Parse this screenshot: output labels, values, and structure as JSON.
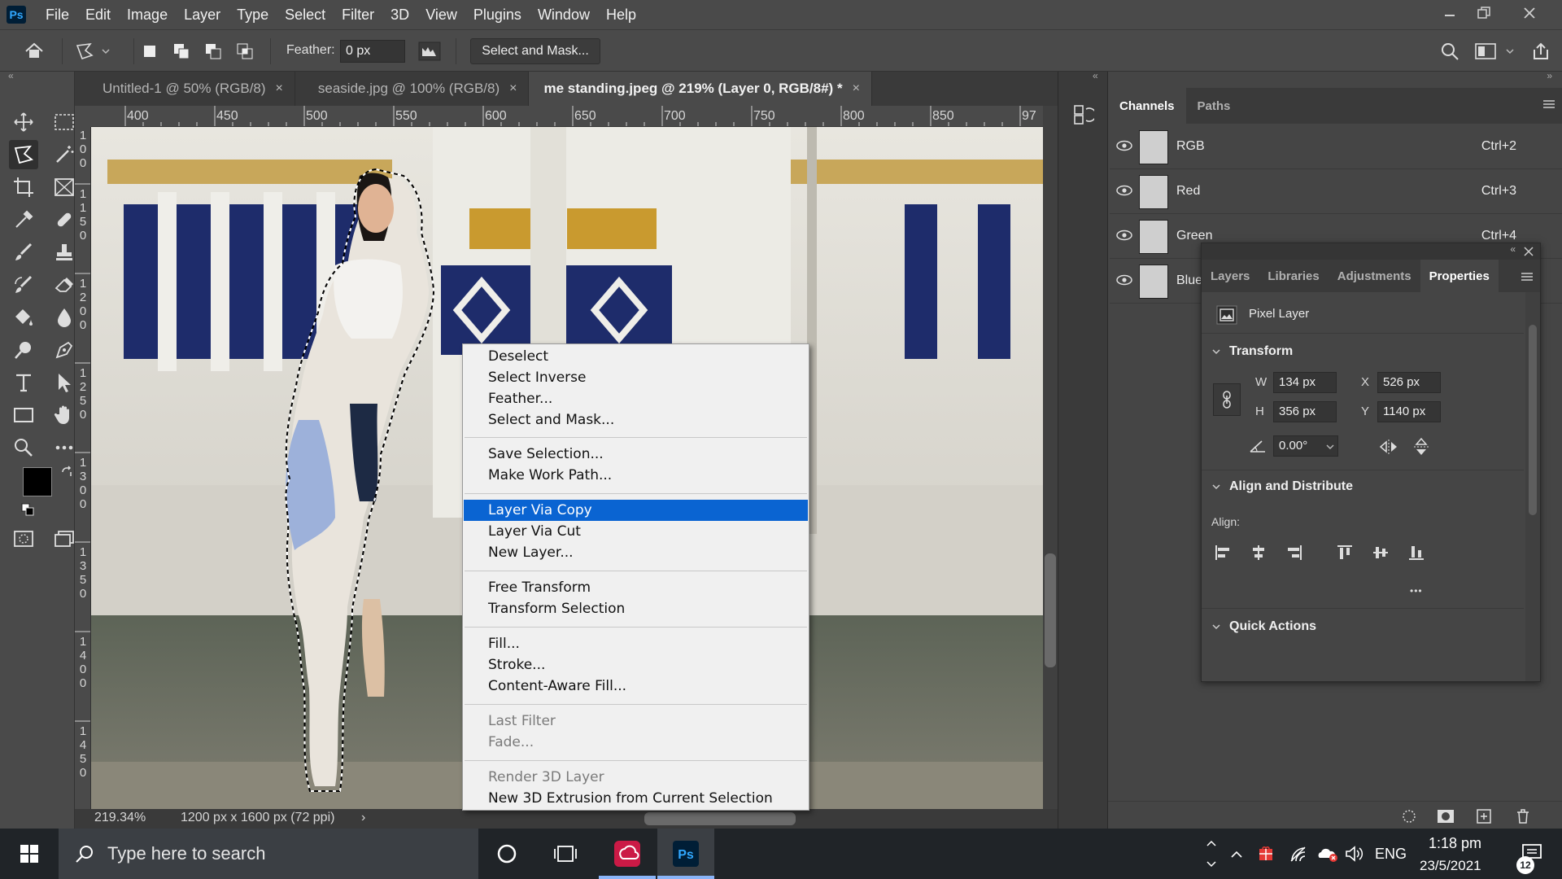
{
  "menubar": {
    "logo": "Ps",
    "items": [
      "File",
      "Edit",
      "Image",
      "Layer",
      "Type",
      "Select",
      "Filter",
      "3D",
      "View",
      "Plugins",
      "Window",
      "Help"
    ]
  },
  "options": {
    "feather_label": "Feather:",
    "feather_value": "0 px",
    "select_mask_label": "Select and Mask..."
  },
  "tabs": [
    {
      "label": "Untitled-1 @ 50% (RGB/8)",
      "active": false
    },
    {
      "label": "seaside.jpg @ 100% (RGB/8)",
      "active": false
    },
    {
      "label": "me standing.jpeg @ 219% (Layer 0, RGB/8#) *",
      "active": true
    }
  ],
  "tab_close": "×",
  "ruler_top": [
    "400",
    "450",
    "500",
    "550",
    "600",
    "650",
    "700",
    "750",
    "800",
    "850",
    "97"
  ],
  "ruler_left": [
    "1\n0\n0",
    "1\n1\n5\n0",
    "1\n2\n0\n0",
    "1\n2\n5\n0",
    "1\n3\n0\n0",
    "1\n3\n5\n0",
    "1\n4\n0\n0",
    "1\n4\n5\n0",
    "0"
  ],
  "status": {
    "zoom": "219.34%",
    "doc_info": "1200 px x 1600 px (72 ppi)",
    "arrow": "›"
  },
  "context_menu": {
    "groups": [
      [
        {
          "label": "Deselect"
        },
        {
          "label": "Select Inverse"
        },
        {
          "label": "Feather..."
        },
        {
          "label": "Select and Mask..."
        }
      ],
      [
        {
          "label": "Save Selection..."
        },
        {
          "label": "Make Work Path..."
        }
      ],
      [
        {
          "label": "Layer Via Copy",
          "highlight": true
        },
        {
          "label": "Layer Via Cut"
        },
        {
          "label": "New Layer..."
        }
      ],
      [
        {
          "label": "Free Transform"
        },
        {
          "label": "Transform Selection"
        }
      ],
      [
        {
          "label": "Fill..."
        },
        {
          "label": "Stroke..."
        },
        {
          "label": "Content-Aware Fill..."
        }
      ],
      [
        {
          "label": "Last Filter",
          "disabled": true
        },
        {
          "label": "Fade...",
          "disabled": true
        }
      ],
      [
        {
          "label": "Render 3D Layer",
          "disabled": true
        },
        {
          "label": "New 3D Extrusion from Current Selection"
        }
      ]
    ]
  },
  "channels": {
    "tabs": [
      "Channels",
      "Paths"
    ],
    "rows": [
      {
        "name": "RGB",
        "shortcut": "Ctrl+2"
      },
      {
        "name": "Red",
        "shortcut": "Ctrl+3"
      },
      {
        "name": "Green",
        "shortcut": "Ctrl+4"
      },
      {
        "name": "Blue",
        "shortcut": ""
      }
    ]
  },
  "properties": {
    "tabs": [
      "Layers",
      "Libraries",
      "Adjustments",
      "Properties"
    ],
    "layer_kind": "Pixel Layer",
    "transform": {
      "heading": "Transform",
      "w_label": "W",
      "w_value": "134 px",
      "h_label": "H",
      "h_value": "356 px",
      "x_label": "X",
      "x_value": "526 px",
      "y_label": "Y",
      "y_value": "1140 px",
      "angle_value": "0.00°"
    },
    "align": {
      "heading": "Align and Distribute",
      "label": "Align:"
    },
    "quick_actions": "Quick Actions",
    "more": "•••"
  },
  "taskbar": {
    "search_placeholder": "Type here to search",
    "language": "ENG",
    "time": "1:18 pm",
    "date": "23/5/2021",
    "notification_count": "12"
  },
  "colors": {
    "accent": "#0a64d2",
    "ps_blue": "#31a8ff",
    "ps_dark": "#001e36"
  }
}
